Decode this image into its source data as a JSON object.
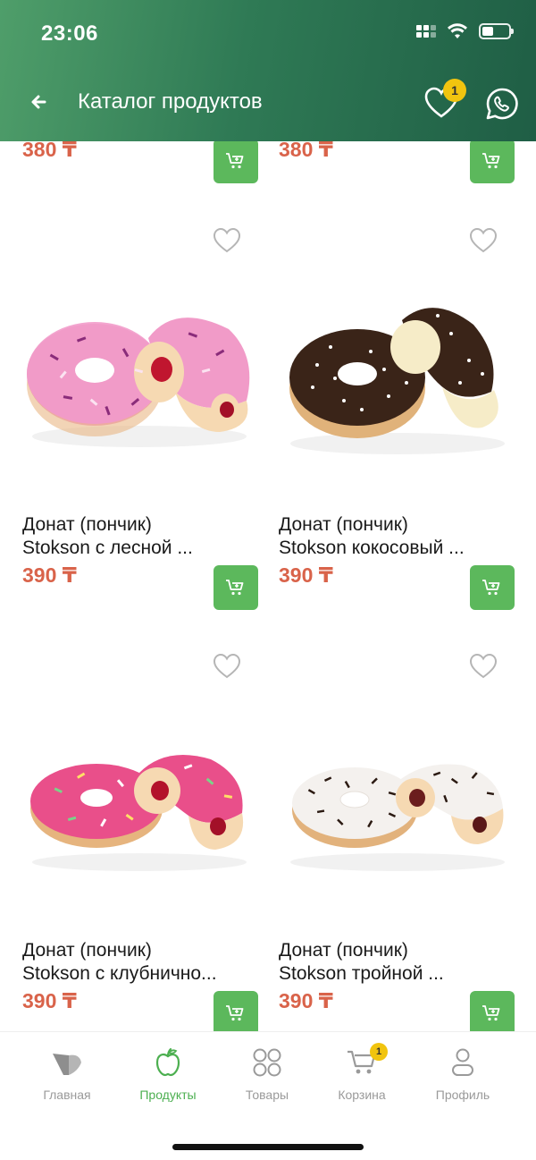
{
  "status": {
    "time": "23:06"
  },
  "header": {
    "title": "Каталог продуктов",
    "favorites_count": "1"
  },
  "top_row": {
    "left_price": "380 ₸",
    "right_price": "380 ₸"
  },
  "products": [
    {
      "name_line1": "Донат (пончик)",
      "name_line2": "Stokson с лесной ...",
      "price": "390 ₸",
      "image": "pink-donut-jam"
    },
    {
      "name_line1": "Донат (пончик)",
      "name_line2": "Stokson кокосовый ...",
      "price": "390 ₸",
      "image": "chocolate-coconut-donut"
    },
    {
      "name_line1": "Донат (пончик)",
      "name_line2": "Stokson с клубнично...",
      "price": "390 ₸",
      "image": "strawberry-donut"
    },
    {
      "name_line1": "Донат (пончик)",
      "name_line2": "Stokson тройной ...",
      "price": "390 ₸",
      "image": "white-chocolate-donut"
    }
  ],
  "tabbar": {
    "items": [
      {
        "label": "Главная",
        "icon": "home-logo-icon"
      },
      {
        "label": "Продукты",
        "icon": "apple-icon"
      },
      {
        "label": "Товары",
        "icon": "grid-circles-icon"
      },
      {
        "label": "Корзина",
        "icon": "cart-icon"
      },
      {
        "label": "Профиль",
        "icon": "profile-icon"
      }
    ],
    "cart_count": "1"
  },
  "colors": {
    "accent": "#5cb85c",
    "price": "#d9634a",
    "header": "#2f7a55",
    "badge": "#f1c40f"
  }
}
